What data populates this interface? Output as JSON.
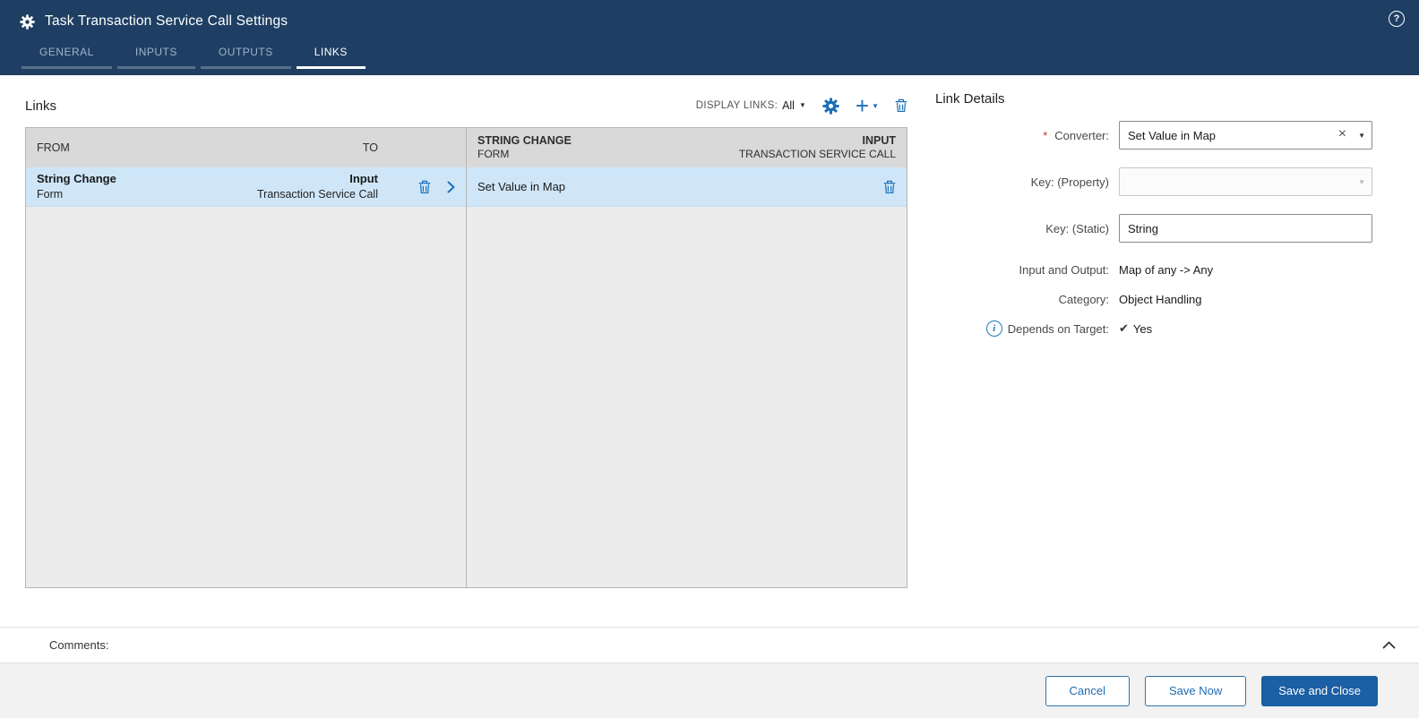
{
  "colors": {
    "header_bg": "#1e3f63",
    "accent_blue": "#1d6fb8",
    "selected_row_bg": "#cfe6f8",
    "primary_button_bg": "#1b5fa4",
    "required_red": "#c0392b"
  },
  "icons": {
    "question_mark": "?",
    "caret_down": "▼",
    "plus": "+",
    "close": "×",
    "info": "i",
    "check": "✔",
    "required_marker": "*"
  },
  "header": {
    "title": "Task Transaction Service Call Settings",
    "tabs": [
      {
        "label": "GENERAL"
      },
      {
        "label": "INPUTS"
      },
      {
        "label": "OUTPUTS"
      },
      {
        "label": "LINKS"
      }
    ]
  },
  "links": {
    "title": "Links",
    "display_links_label": "DISPLAY LINKS:",
    "display_links_value": "All",
    "left_pane": {
      "col_from": "FROM",
      "col_to": "TO",
      "row": {
        "from_name": "String Change",
        "from_type": "Form",
        "to_name": "Input",
        "to_type": "Transaction Service Call"
      }
    },
    "right_pane": {
      "header_from_name": "STRING CHANGE",
      "header_from_type": "FORM",
      "header_to_name": "INPUT",
      "header_to_type": "TRANSACTION SERVICE CALL",
      "row": {
        "converter": "Set Value in Map"
      }
    }
  },
  "details": {
    "title": "Link Details",
    "converter_label": "Converter:",
    "converter_value": "Set Value in Map",
    "key_property_label": "Key: (Property)",
    "key_property_value": "",
    "key_static_label": "Key: (Static)",
    "key_static_value": "String",
    "input_output_label": "Input and Output:",
    "input_output_value": "Map of any -> Any",
    "category_label": "Category:",
    "category_value": "Object Handling",
    "depends_label": "Depends on Target:",
    "depends_value": "Yes"
  },
  "comments": {
    "label": "Comments:"
  },
  "footer": {
    "cancel_label": "Cancel",
    "save_now_label": "Save Now",
    "save_and_close_label": "Save and Close"
  }
}
